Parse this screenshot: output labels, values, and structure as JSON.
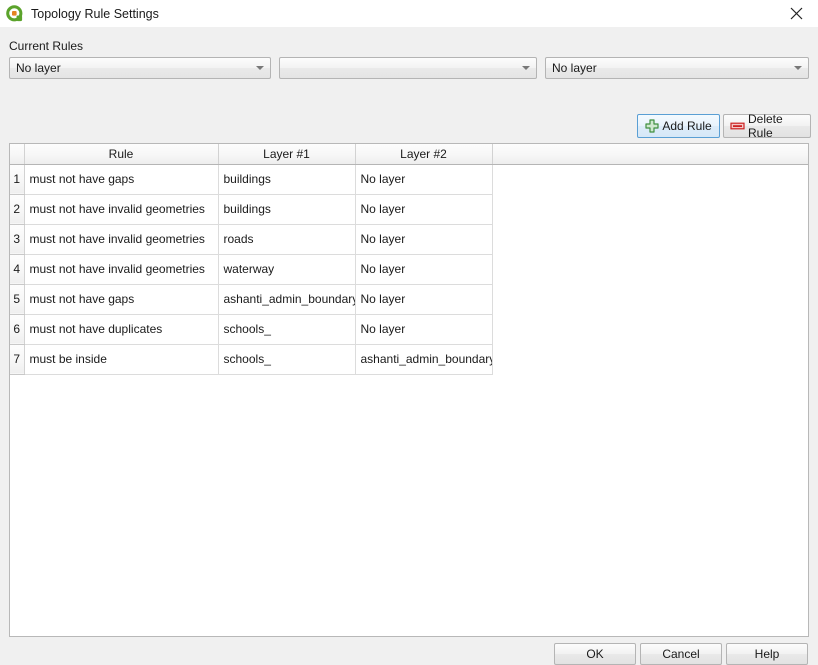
{
  "window": {
    "title": "Topology Rule Settings",
    "app_icon": "qgis-logo-icon",
    "close_icon": "close-icon"
  },
  "form": {
    "current_rules_label": "Current Rules",
    "layer1_combo": {
      "value": "No layer",
      "icon": "chevron-down-icon"
    },
    "rule_combo": {
      "value": "",
      "icon": "chevron-down-icon"
    },
    "layer2_combo": {
      "value": "No layer",
      "icon": "chevron-down-icon"
    }
  },
  "toolbar": {
    "add_rule_label": "Add Rule",
    "add_rule_icon": "green-plus-icon",
    "delete_rule_label": "Delete Rule",
    "delete_rule_icon": "red-minus-icon"
  },
  "table": {
    "headers": [
      "Rule",
      "Layer #1",
      "Layer #2"
    ],
    "rows": [
      {
        "num": "1",
        "rule": "must not have gaps",
        "layer1": "buildings",
        "layer2": "No layer"
      },
      {
        "num": "2",
        "rule": "must not have invalid geometries",
        "layer1": "buildings",
        "layer2": "No layer"
      },
      {
        "num": "3",
        "rule": "must not have invalid geometries",
        "layer1": "roads",
        "layer2": "No layer"
      },
      {
        "num": "4",
        "rule": "must not have invalid geometries",
        "layer1": "waterway",
        "layer2": "No layer"
      },
      {
        "num": "5",
        "rule": "must not have gaps",
        "layer1": "ashanti_admin_boundary",
        "layer2": "No layer"
      },
      {
        "num": "6",
        "rule": "must not have duplicates",
        "layer1": "schools_",
        "layer2": "No layer"
      },
      {
        "num": "7",
        "rule": "must be inside",
        "layer1": "schools_",
        "layer2": "ashanti_admin_boundary"
      }
    ]
  },
  "buttons": {
    "ok": "OK",
    "cancel": "Cancel",
    "help": "Help"
  },
  "colors": {
    "accent_focus": "#5a9fd4",
    "add_icon": "#3f8f3f",
    "delete_icon": "#cc2222",
    "logo_green": "#5ba32b",
    "logo_orange": "#e58422",
    "dialog_bg": "#f0f0f0",
    "titlebar_bg": "#ffffff"
  }
}
